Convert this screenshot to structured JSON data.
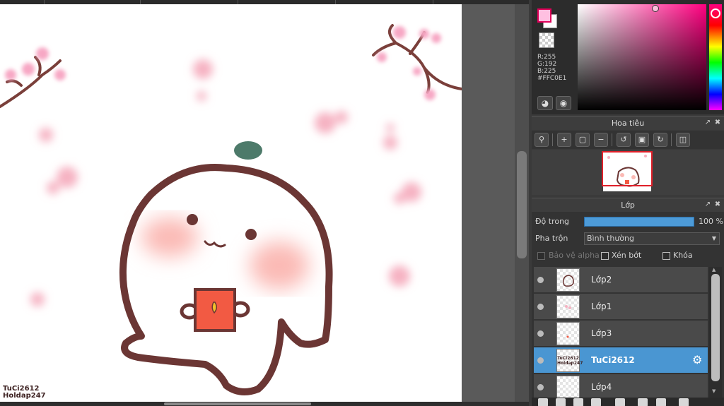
{
  "watermark": {
    "line1": "TuCi2612",
    "line2": "Holdap247"
  },
  "color_panel": {
    "foreground_color": "#FFC0E1",
    "r_text": "R:255",
    "g_text": "G:192",
    "b_text": "B:225",
    "hex_text": "#FFC0E1",
    "hue_color": "#ff0080"
  },
  "navigator": {
    "title": "Hoa tiêu"
  },
  "layers_panel": {
    "title": "Lớp",
    "opacity_label": "Độ trong",
    "opacity_value": "100 %",
    "blend_label": "Pha trộn",
    "blend_value": "Bình thường",
    "protect_alpha_label": "Bảo vệ alpha",
    "clipping_label": "Xén bớt",
    "lock_label": "Khóa",
    "layers": [
      {
        "name": "Lớp2",
        "selected": false
      },
      {
        "name": "Lớp1",
        "selected": false
      },
      {
        "name": "Lớp3",
        "selected": false
      },
      {
        "name": "TuCi2612",
        "selected": true,
        "thumb_text": "TuCi2612 Holdap247"
      },
      {
        "name": "Lớp4",
        "selected": false
      }
    ]
  },
  "icons": {
    "color_tool_1": "palette-icon",
    "color_tool_2": "color-wheel-icon",
    "gear": "settings-gear-icon"
  }
}
